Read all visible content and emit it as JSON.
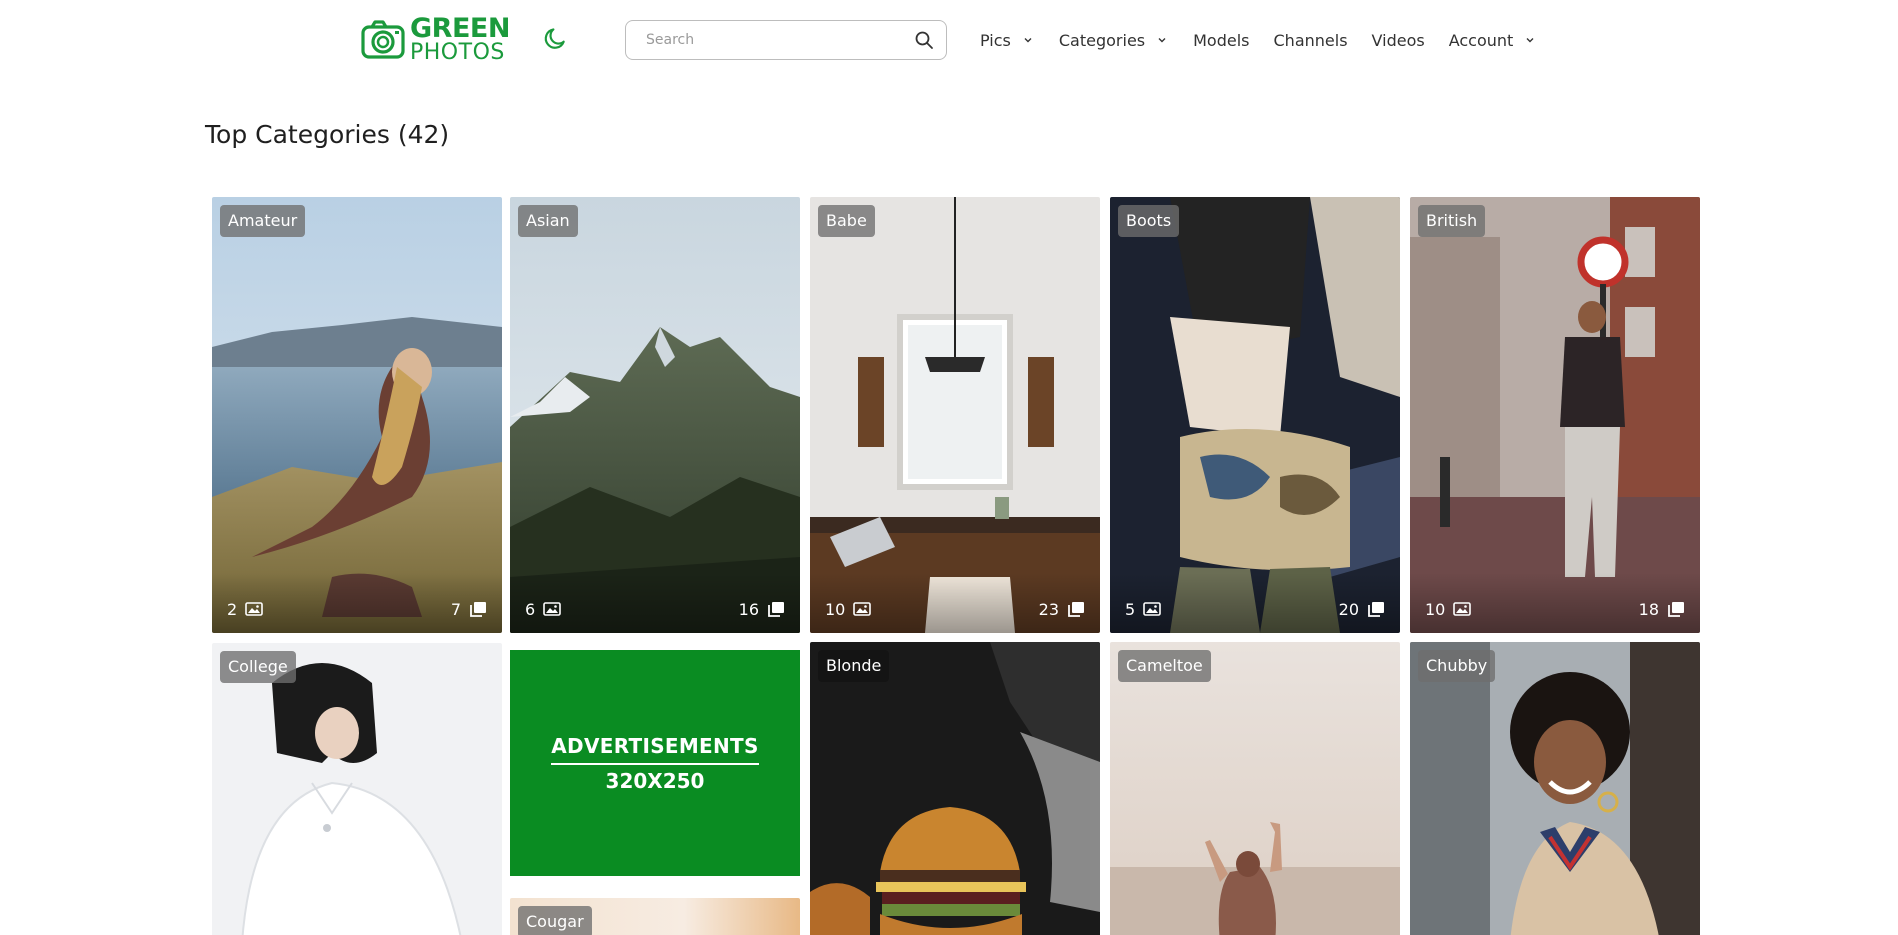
{
  "header": {
    "logo": {
      "line1": "GREEN",
      "line2": "PHOTOS",
      "color": "#1b9a3c"
    },
    "theme_toggle_icon": "moon-icon",
    "search": {
      "placeholder": "Search",
      "value": "",
      "icon": "search-icon"
    },
    "nav": {
      "pics": "Pics",
      "categories": "Categories",
      "models": "Models",
      "channels": "Channels",
      "videos": "Videos",
      "account": "Account"
    }
  },
  "page": {
    "title": "Top Categories (42)"
  },
  "categories": [
    {
      "name": "Amateur",
      "photos": "2",
      "galleries": "7"
    },
    {
      "name": "Asian",
      "photos": "6",
      "galleries": "16"
    },
    {
      "name": "Babe",
      "photos": "10",
      "galleries": "23"
    },
    {
      "name": "Boots",
      "photos": "5",
      "galleries": "20"
    },
    {
      "name": "British",
      "photos": "10",
      "galleries": "18"
    },
    {
      "name": "College"
    },
    {
      "name": "Blonde"
    },
    {
      "name": "Cameltoe"
    },
    {
      "name": "Chubby"
    },
    {
      "name": "Cougar"
    }
  ],
  "ad": {
    "line1": "ADVERTISEMENTS",
    "line2": "320X250",
    "color": "#0a8c22"
  },
  "icons": {
    "photo_count": "image-icon",
    "gallery_count": "gallery-icon"
  }
}
